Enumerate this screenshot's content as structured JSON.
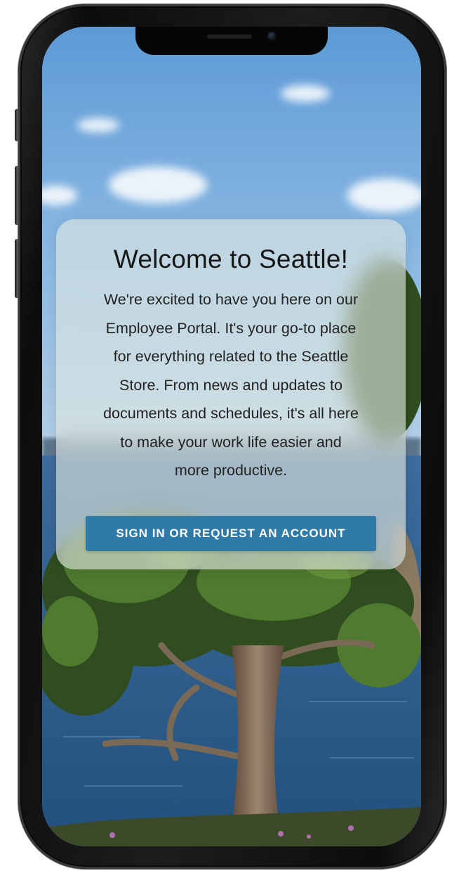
{
  "welcome": {
    "title": "Welcome to Seattle!",
    "body_lines": [
      "We're excited to have you here on our",
      "Employee Portal. It's your go-to place",
      "for everything related to the Seattle",
      "Store. From news and updates to",
      "documents and schedules, it's all here",
      "to make your work life easier and",
      "more productive."
    ],
    "cta_label": "SIGN IN OR REQUEST AN ACCOUNT"
  },
  "colors": {
    "cta_background": "#2e7aa8",
    "cta_text": "#ffffff",
    "card_background": "rgba(225,232,226,0.62)",
    "sky": "#6aa0d4",
    "water": "#2f5f92"
  },
  "background_image": "tree-by-the-lake-photo"
}
